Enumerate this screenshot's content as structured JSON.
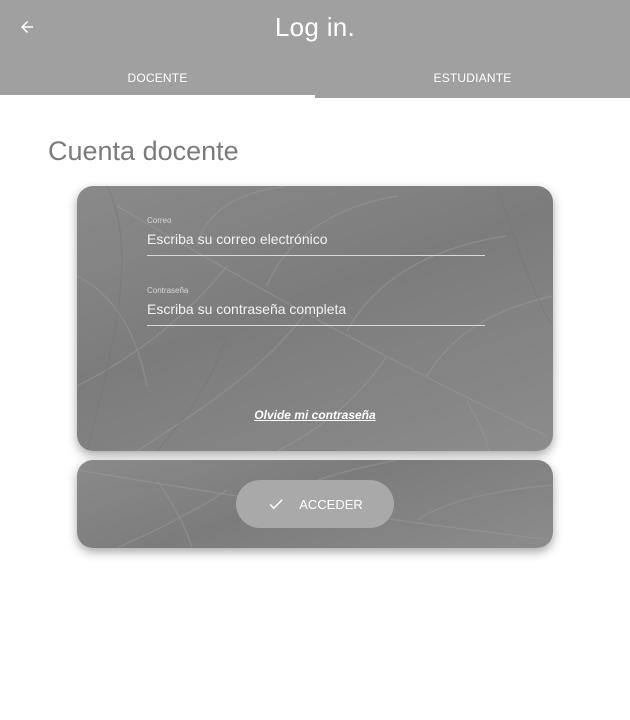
{
  "header": {
    "back_icon": "arrow-left-icon",
    "title": "Log in.",
    "tabs": [
      {
        "label": "DOCENTE",
        "selected": true
      },
      {
        "label": "ESTUDIANTE",
        "selected": false
      }
    ]
  },
  "main": {
    "section_title": "Cuenta docente",
    "form": {
      "email": {
        "label": "Correo",
        "placeholder": "Escriba su correo electrónico",
        "value": ""
      },
      "password": {
        "label": "Contraseña",
        "placeholder": "Escriba su contraseña completa",
        "value": ""
      },
      "forgot_link": "Olvide mi contraseña"
    },
    "submit": {
      "label": "ACCEDER",
      "icon": "check-icon"
    }
  },
  "colors": {
    "appbar": "#a0a0a0",
    "card": "#848484",
    "button": "#a9a9a9",
    "section_title": "#7b7b7b"
  }
}
